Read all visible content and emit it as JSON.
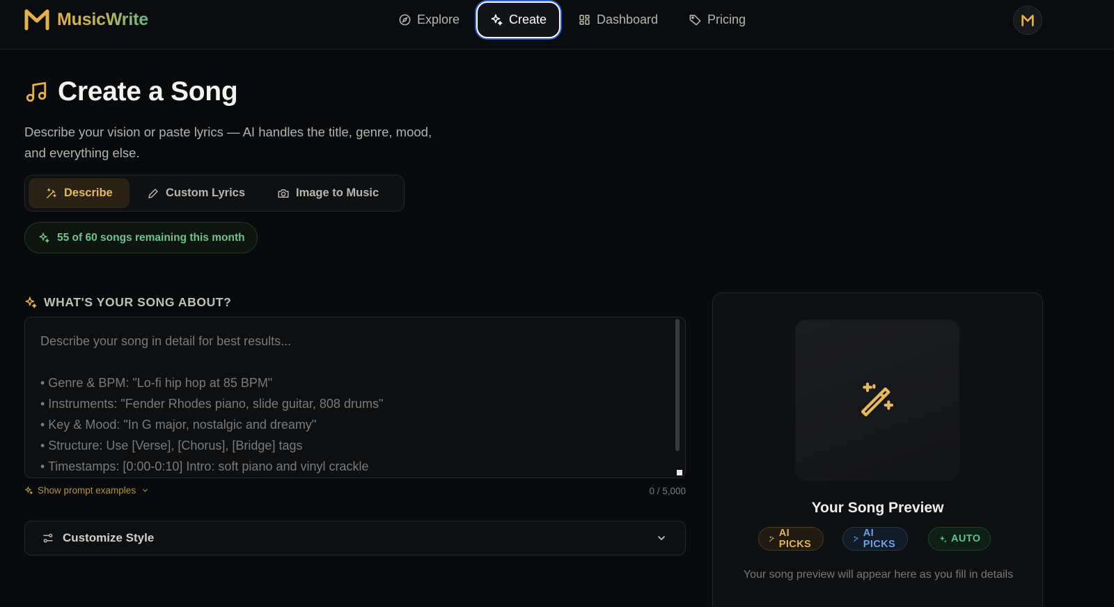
{
  "app": {
    "name": "MusicWrite",
    "avatar_letter": "M"
  },
  "nav": {
    "items": [
      {
        "label": "Explore",
        "icon": "compass-icon"
      },
      {
        "label": "Create",
        "icon": "sparkles-icon",
        "active": true
      },
      {
        "label": "Dashboard",
        "icon": "grid-icon"
      },
      {
        "label": "Pricing",
        "icon": "tag-icon"
      }
    ]
  },
  "page": {
    "title": "Create a Song",
    "subtitle": "Describe your vision or paste lyrics — AI handles the title, genre, mood, and everything else."
  },
  "mode_tabs": [
    {
      "label": "Describe",
      "icon": "wand-icon",
      "active": true
    },
    {
      "label": "Custom Lyrics",
      "icon": "pencil-icon"
    },
    {
      "label": "Image to Music",
      "icon": "camera-icon"
    }
  ],
  "quota": {
    "text": "55 of 60 songs remaining this month",
    "used": 5,
    "remaining": 55,
    "limit": 60
  },
  "prompt": {
    "heading": "WHAT'S YOUR SONG ABOUT?",
    "placeholder_lines": [
      "Describe your song in detail for best results...",
      "",
      "• Genre & BPM: \"Lo-fi hip hop at 85 BPM\"",
      "• Instruments: \"Fender Rhodes piano, slide guitar, 808 drums\"",
      "• Key & Mood: \"In G major, nostalgic and dreamy\"",
      "• Structure: Use [Verse], [Chorus], [Bridge] tags",
      "• Timestamps: [0:00-0:10] Intro: soft piano and vinyl crackle"
    ],
    "value": "",
    "examples_link": "Show prompt examples",
    "char_count": "0 / 5,000"
  },
  "customize": {
    "label": "Customize Style"
  },
  "preview": {
    "title": "Your Song Preview",
    "badges": [
      {
        "label": "AI PICKS",
        "variant": "gold",
        "icon": "wand-icon"
      },
      {
        "label": "AI PICKS",
        "variant": "blue",
        "icon": "wand-icon"
      },
      {
        "label": "AUTO",
        "variant": "green",
        "icon": "sparkles-icon"
      }
    ],
    "hint": "Your song preview will appear here as you fill in details"
  },
  "colors": {
    "background": "#090a0c",
    "accent_gold": "#e7b862",
    "accent_green": "#72c28b",
    "accent_blue": "#6fa3df",
    "focus_ring": "#2f5fd0"
  }
}
